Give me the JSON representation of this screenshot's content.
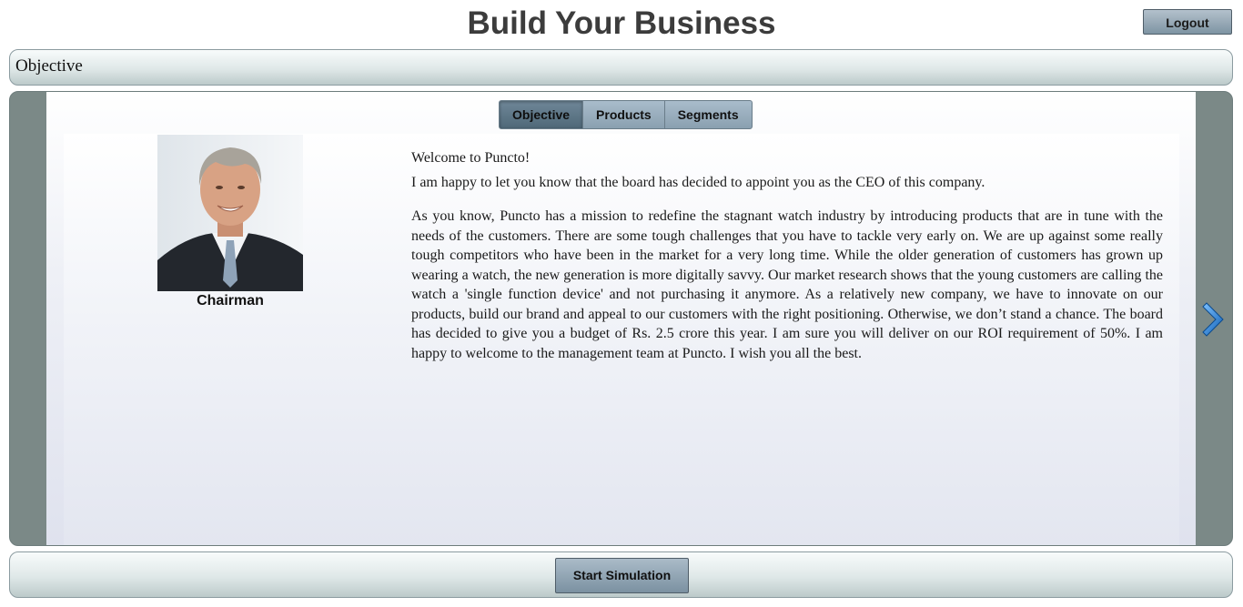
{
  "header": {
    "title": "Build Your Business",
    "logout_label": "Logout"
  },
  "section_bar": {
    "label": "Objective"
  },
  "tabs": [
    {
      "label": "Objective",
      "active": true
    },
    {
      "label": "Products",
      "active": false
    },
    {
      "label": "Segments",
      "active": false
    }
  ],
  "portrait": {
    "caption": "Chairman",
    "icon": "chairman-portrait"
  },
  "message": {
    "greeting": "Welcome to Puncto!",
    "intro": "I am happy to let you know that the board has decided to appoint you as the CEO of this company.",
    "body": "As you know, Puncto has a mission to redefine the stagnant watch industry by introducing products that are in tune with the needs of the customers. There are some tough challenges that you have to tackle very early on. We are up against some really tough competitors who have been in the market for a very long time. While the older generation of customers has grown up wearing a watch, the new generation is more digitally savvy. Our market research shows that the young customers are calling the watch a 'single function device' and not purchasing  it anymore. As a relatively new company, we have to innovate on our products, build our brand and appeal to our customers with the right positioning. Otherwise, we don’t stand a chance. The board has decided to give you a budget of Rs. 2.5 crore this year. I am sure you will deliver on our ROI requirement of 50%. I am happy to welcome to the management team at Puncto. I wish you all the best."
  },
  "navigation": {
    "next_icon": "chevron-right-icon"
  },
  "footer": {
    "start_label": "Start Simulation"
  },
  "colors": {
    "accent": "#1f74c7",
    "panel_side": "#7b8987",
    "button": "#8aa0b0"
  }
}
